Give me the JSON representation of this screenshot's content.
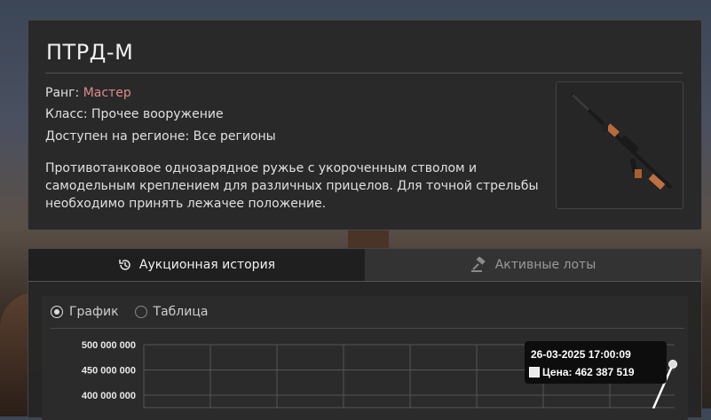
{
  "item": {
    "title": "ПТРД-М",
    "rank_label": "Ранг: ",
    "rank_value": "Мастер",
    "class_line": "Класс: Прочее вооружение",
    "region_line": "Доступен на регионе: Все регионы",
    "description": "Противотанковое однозарядное ружье с укороченным стволом и самодельным креплением для различных прицелов. Для точной стрельбы необходимо принять лежачее положение."
  },
  "tabs": [
    {
      "label": "Аукционная история",
      "icon": "history-icon",
      "active": true
    },
    {
      "label": "Активные лоты",
      "icon": "gavel-icon",
      "active": false
    }
  ],
  "view_toggle": {
    "chart_label": "График",
    "table_label": "Таблица",
    "selected": "chart"
  },
  "chart_data": {
    "type": "line",
    "y_ticks": [
      "500 000 000",
      "450 000 000",
      "400 000 000"
    ],
    "ylim": [
      400000000,
      500000000
    ],
    "grid": true,
    "points": [
      {
        "x": "26-03-2025 17:00:09",
        "y": 462387519
      }
    ]
  },
  "tooltip": {
    "date": "26-03-2025 17:00:09",
    "price_line": "Цена: 462 387 519"
  },
  "colors": {
    "rank_accent": "#e08a8a",
    "line": "#ffffff"
  }
}
